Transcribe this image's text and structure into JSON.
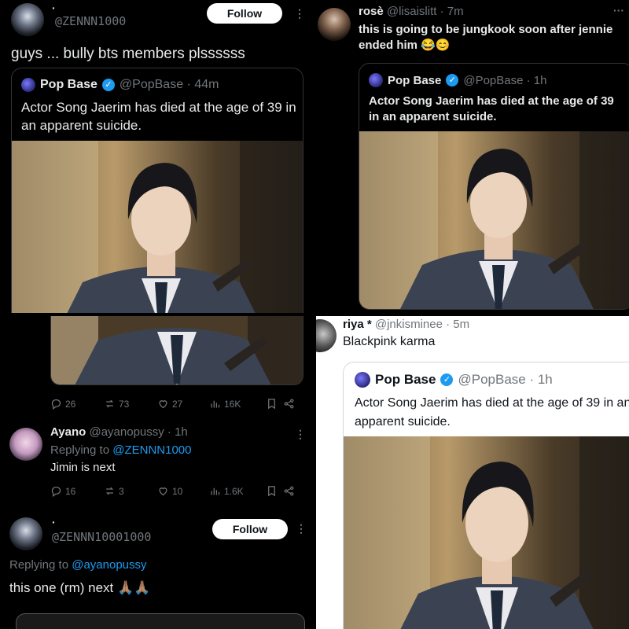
{
  "panel1": {
    "dot": "·",
    "handle": "@ZENNN1000",
    "follow_label": "Follow",
    "more": "⋮",
    "text": "guys ... bully bts members plssssss",
    "quote": {
      "name": "Pop Base",
      "handle_time": "@PopBase · 44m",
      "text": "Actor Song Jaerim has died at the age of 39 in an apparent suicide."
    }
  },
  "panel2": {
    "name": "rosè",
    "handle_time": "@lisaislitt · 7m",
    "more": "···",
    "text": "this is going to be jungkook soon after jennie ended him 😂😊",
    "quote": {
      "name": "Pop Base",
      "handle_time": "@PopBase · 1h",
      "text": "Actor Song Jaerim has died at the age of 39 in an apparent suicide."
    }
  },
  "panel3": {
    "actions": {
      "replies": "26",
      "reposts": "73",
      "likes": "27",
      "views": "16K"
    },
    "reply1": {
      "name": "Ayano",
      "handle_time": "@ayanopussy · 1h",
      "replying_prefix": "Replying to",
      "replying_to": "@ZENNN1000",
      "text": "Jimin is next",
      "more": "⋮",
      "actions": {
        "replies": "16",
        "reposts": "3",
        "likes": "10",
        "views": "1.6K"
      }
    },
    "reply2": {
      "dot": "·",
      "handle": "@ZENNN10001000",
      "follow_label": "Follow",
      "more": "⋮",
      "replying_prefix": "Replying to",
      "replying_to": "@ayanopussy",
      "text": "this one (rm) next 🙏🏽🙏🏽"
    }
  },
  "panel4": {
    "name": "riya *",
    "handle_time": "@jnkisminee · 5m",
    "text": "Blackpink karma",
    "quote": {
      "name": "Pop Base",
      "handle_time": "@PopBase · 1h",
      "text": "Actor Song Jaerim has died at the age of 39 in an apparent suicide."
    }
  },
  "colors": {
    "accent": "#1d9bf0",
    "muted": "#71767b",
    "dark_bg": "#000000",
    "light_bg": "#ffffff"
  }
}
